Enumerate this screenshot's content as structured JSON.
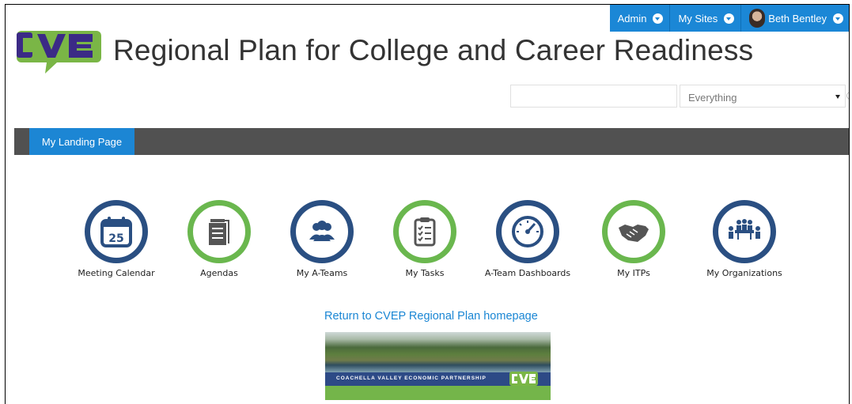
{
  "topbar": {
    "admin_label": "Admin",
    "my_sites_label": "My Sites",
    "user_name": "Beth Bentley"
  },
  "site": {
    "logo_text": "CVE",
    "title": "Regional Plan for College and Career Readiness"
  },
  "search": {
    "value": "",
    "scope_selected": "Everything"
  },
  "nav": {
    "tabs": [
      {
        "label": "My Landing Page"
      }
    ]
  },
  "tiles": [
    {
      "label": "Meeting Calendar",
      "icon": "calendar-icon",
      "ring": "blue",
      "calendar_day": "25"
    },
    {
      "label": "Agendas",
      "icon": "notepad-icon",
      "ring": "green"
    },
    {
      "label": "My A-Teams",
      "icon": "team-icon",
      "ring": "blue"
    },
    {
      "label": "My Tasks",
      "icon": "checklist-icon",
      "ring": "green"
    },
    {
      "label": "A-Team Dashboards",
      "icon": "gauge-icon",
      "ring": "blue"
    },
    {
      "label": "My ITPs",
      "icon": "handshake-icon",
      "ring": "green"
    },
    {
      "label": "My Organizations",
      "icon": "meeting-people-icon",
      "ring": "blue"
    }
  ],
  "return_link": "Return to CVEP Regional Plan homepage",
  "banner": {
    "caption": "COACHELLA VALLEY ECONOMIC PARTNERSHIP",
    "logo_text": "CVE"
  },
  "colors": {
    "topbar_blue": "#1b87d6",
    "nav_dark": "#515151",
    "ring_blue": "#2a4f82",
    "ring_green": "#6ab74e",
    "link_blue": "#1a86d4"
  }
}
